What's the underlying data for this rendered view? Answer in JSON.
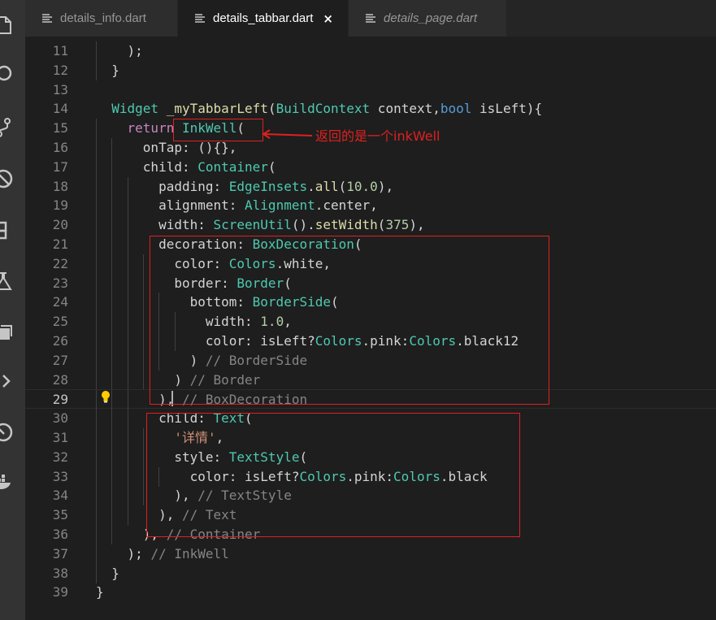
{
  "tabs": [
    {
      "label": "details_info.dart",
      "active": false,
      "italic": false
    },
    {
      "label": "details_tabbar.dart",
      "active": true,
      "italic": false,
      "close_icon": "×"
    },
    {
      "label": "details_page.dart",
      "active": false,
      "italic": true
    }
  ],
  "activity_icons": [
    "files-icon",
    "search-icon",
    "source-control-icon",
    "debug-icon",
    "extensions-icon",
    "flask-icon",
    "copy-icon",
    "chevron-right-icon",
    "gauge-icon",
    "docker-icon"
  ],
  "editor": {
    "lines": [
      {
        "n": "11",
        "indent": 1,
        "tokens": [
          [
            "",
            "    );"
          ]
        ]
      },
      {
        "n": "12",
        "indent": 1,
        "tokens": [
          [
            "",
            "  }"
          ]
        ]
      },
      {
        "n": "13",
        "indent": 0,
        "tokens": []
      },
      {
        "n": "14",
        "indent": 0,
        "tokens": [
          [
            "ty",
            "  Widget"
          ],
          [
            "",
            " "
          ],
          [
            "fn",
            "_myTabbarLeft"
          ],
          [
            "",
            "("
          ],
          [
            "ty",
            "BuildContext"
          ],
          [
            "",
            " context,"
          ],
          [
            "kw",
            "bool"
          ],
          [
            "",
            " isLeft){"
          ]
        ]
      },
      {
        "n": "15",
        "indent": 1,
        "tokens": [
          [
            "",
            "    "
          ],
          [
            "ctl",
            "return"
          ],
          [
            "",
            " "
          ],
          [
            "ty",
            "InkWell"
          ],
          [
            "",
            "("
          ]
        ]
      },
      {
        "n": "16",
        "indent": 2,
        "tokens": [
          [
            "",
            "      onTap: (){},"
          ]
        ]
      },
      {
        "n": "17",
        "indent": 2,
        "tokens": [
          [
            "",
            "      child: "
          ],
          [
            "ty",
            "Container"
          ],
          [
            "",
            "("
          ]
        ]
      },
      {
        "n": "18",
        "indent": 3,
        "tokens": [
          [
            "",
            "        padding: "
          ],
          [
            "ty",
            "EdgeInsets"
          ],
          [
            "",
            "."
          ],
          [
            "fn",
            "all"
          ],
          [
            "",
            "("
          ],
          [
            "nu",
            "10.0"
          ],
          [
            "",
            "),"
          ]
        ]
      },
      {
        "n": "19",
        "indent": 3,
        "tokens": [
          [
            "",
            "        alignment: "
          ],
          [
            "ty",
            "Alignment"
          ],
          [
            "",
            ".center,"
          ]
        ]
      },
      {
        "n": "20",
        "indent": 3,
        "tokens": [
          [
            "",
            "        width: "
          ],
          [
            "ty",
            "ScreenUtil"
          ],
          [
            "",
            "()."
          ],
          [
            "fn",
            "setWidth"
          ],
          [
            "",
            "("
          ],
          [
            "nu",
            "375"
          ],
          [
            "",
            "),"
          ]
        ]
      },
      {
        "n": "21",
        "indent": 3,
        "tokens": [
          [
            "",
            "        decoration: "
          ],
          [
            "ty",
            "BoxDecoration"
          ],
          [
            "",
            "("
          ]
        ]
      },
      {
        "n": "22",
        "indent": 4,
        "tokens": [
          [
            "",
            "          color: "
          ],
          [
            "ty",
            "Colors"
          ],
          [
            "",
            ".white,"
          ]
        ]
      },
      {
        "n": "23",
        "indent": 4,
        "tokens": [
          [
            "",
            "          border: "
          ],
          [
            "ty",
            "Border"
          ],
          [
            "",
            "("
          ]
        ]
      },
      {
        "n": "24",
        "indent": 5,
        "tokens": [
          [
            "",
            "            bottom: "
          ],
          [
            "ty",
            "BorderSide"
          ],
          [
            "",
            "("
          ]
        ]
      },
      {
        "n": "25",
        "indent": 6,
        "tokens": [
          [
            "",
            "              width: "
          ],
          [
            "nu",
            "1.0"
          ],
          [
            "",
            ","
          ]
        ]
      },
      {
        "n": "26",
        "indent": 6,
        "tokens": [
          [
            "",
            "              color: isLeft?"
          ],
          [
            "ty",
            "Colors"
          ],
          [
            "",
            ".pink:"
          ],
          [
            "ty",
            "Colors"
          ],
          [
            "",
            ".black12"
          ]
        ]
      },
      {
        "n": "27",
        "indent": 5,
        "tokens": [
          [
            "",
            "            ) "
          ],
          [
            "cmg",
            "// BorderSide"
          ]
        ]
      },
      {
        "n": "28",
        "indent": 4,
        "tokens": [
          [
            "",
            "          ) "
          ],
          [
            "cmg",
            "// Border"
          ]
        ]
      },
      {
        "n": "29",
        "indent": 3,
        "current": true,
        "tokens": [
          [
            "",
            "        ), "
          ],
          [
            "cmg",
            "// BoxDecoration"
          ]
        ]
      },
      {
        "n": "30",
        "indent": 3,
        "tokens": [
          [
            "",
            "        child: "
          ],
          [
            "ty",
            "Text"
          ],
          [
            "",
            "("
          ]
        ]
      },
      {
        "n": "31",
        "indent": 4,
        "tokens": [
          [
            "",
            "          "
          ],
          [
            "st",
            "'详情'"
          ],
          [
            "",
            ","
          ]
        ]
      },
      {
        "n": "32",
        "indent": 4,
        "tokens": [
          [
            "",
            "          style: "
          ],
          [
            "ty",
            "TextStyle"
          ],
          [
            "",
            "("
          ]
        ]
      },
      {
        "n": "33",
        "indent": 5,
        "tokens": [
          [
            "",
            "            color: isLeft?"
          ],
          [
            "ty",
            "Colors"
          ],
          [
            "",
            ".pink:"
          ],
          [
            "ty",
            "Colors"
          ],
          [
            "",
            ".black"
          ]
        ]
      },
      {
        "n": "34",
        "indent": 4,
        "tokens": [
          [
            "",
            "          ), "
          ],
          [
            "cmg",
            "// TextStyle"
          ]
        ]
      },
      {
        "n": "35",
        "indent": 3,
        "tokens": [
          [
            "",
            "        ), "
          ],
          [
            "cmg",
            "// Text"
          ]
        ]
      },
      {
        "n": "36",
        "indent": 2,
        "tokens": [
          [
            "",
            "      ), "
          ],
          [
            "cmg",
            "// Container"
          ]
        ]
      },
      {
        "n": "37",
        "indent": 1,
        "tokens": [
          [
            "",
            "    ); "
          ],
          [
            "cmg",
            "// InkWell"
          ]
        ]
      },
      {
        "n": "38",
        "indent": 1,
        "tokens": [
          [
            "",
            "  }"
          ]
        ]
      },
      {
        "n": "39",
        "indent": 0,
        "tokens": [
          [
            "",
            "}"
          ]
        ]
      }
    ]
  },
  "annotation": {
    "label": "返回的是一个inkWell",
    "color": "#e0201f"
  },
  "colors": {
    "background": "#1e1e1e",
    "activity_bar": "#333333",
    "tab_bar": "#252526",
    "annotation": "#e0201f"
  }
}
